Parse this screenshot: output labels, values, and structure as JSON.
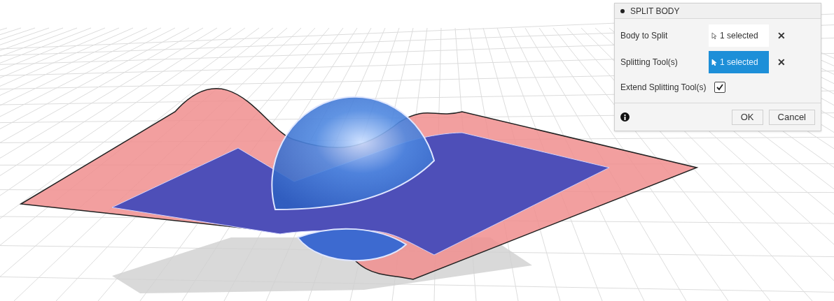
{
  "dialog": {
    "title": "SPLIT BODY",
    "selections": [
      {
        "label": "Body to Split",
        "value": "1 selected",
        "active": false,
        "clear": "✕"
      },
      {
        "label": "Splitting Tool(s)",
        "value": "1 selected",
        "active": true,
        "clear": "✕"
      }
    ],
    "option": {
      "label": "Extend Splitting Tool(s)",
      "checked": true
    },
    "buttons": [
      "OK",
      "Cancel"
    ]
  }
}
